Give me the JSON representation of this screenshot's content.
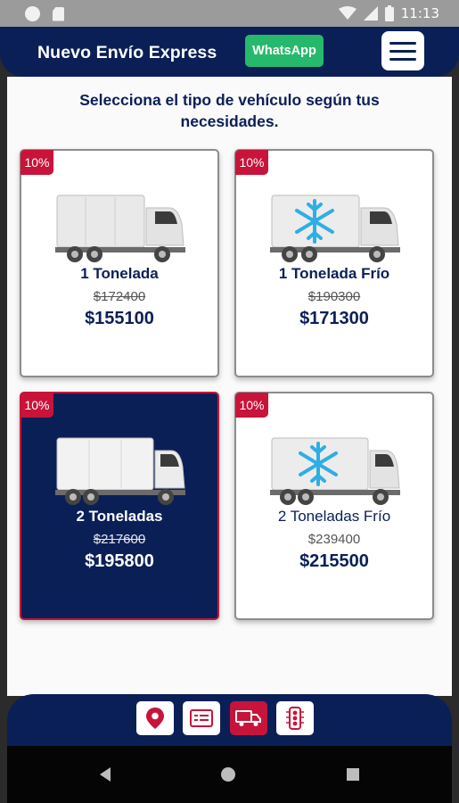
{
  "status_bar": {
    "time": "11:13"
  },
  "header": {
    "title": "Nuevo Envío Express",
    "whatsapp_label": "WhatsApp"
  },
  "subtitle_line1": "Selecciona el tipo de vehículo según tus",
  "subtitle_line2": "necesidades.",
  "vehicles": [
    {
      "badge": "10%",
      "name": "1 Tonelada",
      "old_price": "$172400",
      "price": "$155100",
      "refrigerated": false,
      "selected": false
    },
    {
      "badge": "10%",
      "name": "1 Tonelada Frío",
      "old_price": "$190300",
      "price": "$171300",
      "refrigerated": true,
      "selected": false
    },
    {
      "badge": "10%",
      "name": "2 Toneladas",
      "old_price": "$217600",
      "price": "$195800",
      "refrigerated": false,
      "selected": true
    },
    {
      "badge": "10%",
      "name": "2 Toneladas Frío",
      "old_price": "$239400",
      "price": "$215500",
      "refrigerated": true,
      "selected": false
    }
  ],
  "bottom_nav": [
    {
      "icon": "location-pin-icon",
      "active": false
    },
    {
      "icon": "form-card-icon",
      "active": false
    },
    {
      "icon": "truck-icon",
      "active": true
    },
    {
      "icon": "traffic-light-icon",
      "active": false
    }
  ],
  "colors": {
    "navy": "#0b1f57",
    "accent_red": "#c8143a",
    "whatsapp_green": "#27b96b",
    "snowflake_blue": "#2eaee4"
  }
}
